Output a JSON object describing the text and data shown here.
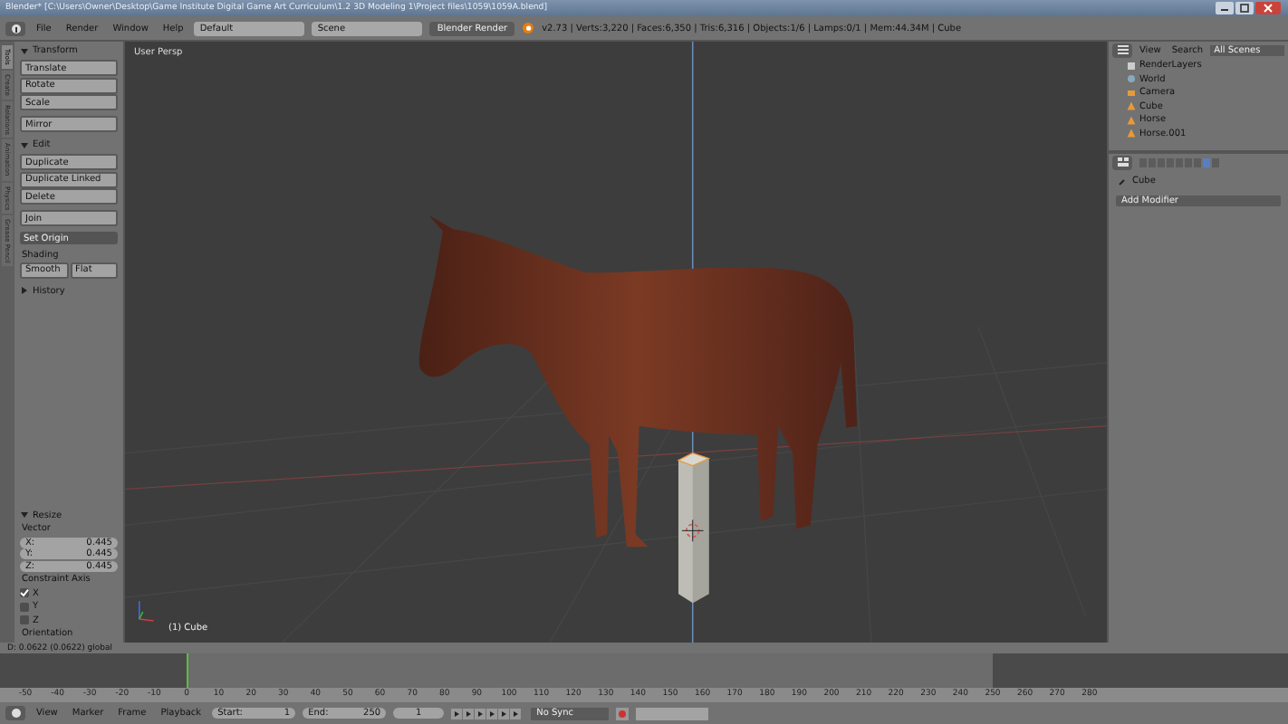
{
  "title_bar": {
    "title": "Blender* [C:\\Users\\Owner\\Desktop\\Game Institute Digital Game Art Curriculum\\1.2 3D Modeling 1\\Project files\\1059\\1059A.blend]"
  },
  "header": {
    "menu": [
      "File",
      "Render",
      "Window",
      "Help"
    ],
    "layout": "Default",
    "scene": "Scene",
    "engine": "Blender Render",
    "stats": "v2.73 | Verts:3,220 | Faces:6,350 | Tris:6,316 | Objects:1/6 | Lamps:0/1 | Mem:44.34M | Cube"
  },
  "tool_tabs": [
    {
      "label": "Tools",
      "selected": true
    },
    {
      "label": "Create",
      "selected": false
    },
    {
      "label": "Relations",
      "selected": false
    },
    {
      "label": "Animation",
      "selected": false
    },
    {
      "label": "Physics",
      "selected": false
    },
    {
      "label": "Grease Pencil",
      "selected": false
    }
  ],
  "tool_sections": [
    {
      "title": "Transform",
      "expanded": true,
      "groups": [
        [
          {
            "kind": "button",
            "labels": [
              "Translate"
            ]
          },
          {
            "kind": "button",
            "labels": [
              "Rotate"
            ]
          },
          {
            "kind": "button",
            "labels": [
              "Scale"
            ]
          }
        ],
        [
          {
            "kind": "button",
            "labels": [
              "Mirror"
            ]
          }
        ]
      ]
    },
    {
      "title": "Edit",
      "expanded": true,
      "groups": [
        [
          {
            "kind": "button",
            "labels": [
              "Duplicate"
            ]
          },
          {
            "kind": "button",
            "labels": [
              "Duplicate Linked"
            ]
          },
          {
            "kind": "button",
            "labels": [
              "Delete"
            ]
          }
        ],
        [
          {
            "kind": "button",
            "labels": [
              "Join"
            ]
          }
        ],
        [
          {
            "kind": "dropdown",
            "labels": [
              "Set Origin"
            ]
          }
        ],
        [
          {
            "kind": "label",
            "labels": [
              "Shading"
            ]
          },
          {
            "kind": "button",
            "labels": [
              "Smooth",
              "Flat"
            ]
          }
        ]
      ]
    },
    {
      "title": "History",
      "expanded": false
    }
  ],
  "operator_panel": {
    "title": "Resize",
    "expanded": true,
    "vector_label": "Vector",
    "vector": [
      {
        "axis": "X:",
        "value": "0.445"
      },
      {
        "axis": "Y:",
        "value": "0.445"
      },
      {
        "axis": "Z:",
        "value": "0.445"
      }
    ],
    "constraint_label": "Constraint Axis",
    "constraint": [
      {
        "axis": "X",
        "checked": true
      },
      {
        "axis": "Y",
        "checked": false
      },
      {
        "axis": "Z",
        "checked": false
      }
    ],
    "orientation_label": "Orientation"
  },
  "viewport": {
    "view_name": "User Persp",
    "object_label": "(1) Cube"
  },
  "status": "D: 0.0622 (0.0622) global",
  "outliner": {
    "tabs": [
      "View",
      "Search"
    ],
    "filter": "All Scenes",
    "items": [
      {
        "name": "RenderLayers",
        "kind": "renderlayers"
      },
      {
        "name": "World",
        "kind": "world"
      },
      {
        "name": "Camera",
        "kind": "camera"
      },
      {
        "name": "Cube",
        "kind": "mesh"
      },
      {
        "name": "Horse",
        "kind": "mesh"
      },
      {
        "name": "Horse.001",
        "kind": "mesh"
      }
    ]
  },
  "properties": {
    "object": "Cube",
    "add_modifier": "Add Modifier"
  },
  "timeline": {
    "ticks": [
      "-50",
      "-40",
      "-30",
      "-20",
      "-10",
      "0",
      "10",
      "20",
      "30",
      "40",
      "50",
      "60",
      "70",
      "80",
      "90",
      "100",
      "110",
      "120",
      "130",
      "140",
      "150",
      "160",
      "170",
      "180",
      "190",
      "200",
      "210",
      "220",
      "230",
      "240",
      "250",
      "260",
      "270",
      "280"
    ],
    "menu": [
      "View",
      "Marker",
      "Frame",
      "Playback"
    ],
    "start_label": "Start:",
    "start": "1",
    "end_label": "End:",
    "end": "250",
    "frame": "1",
    "sync": "No Sync"
  }
}
